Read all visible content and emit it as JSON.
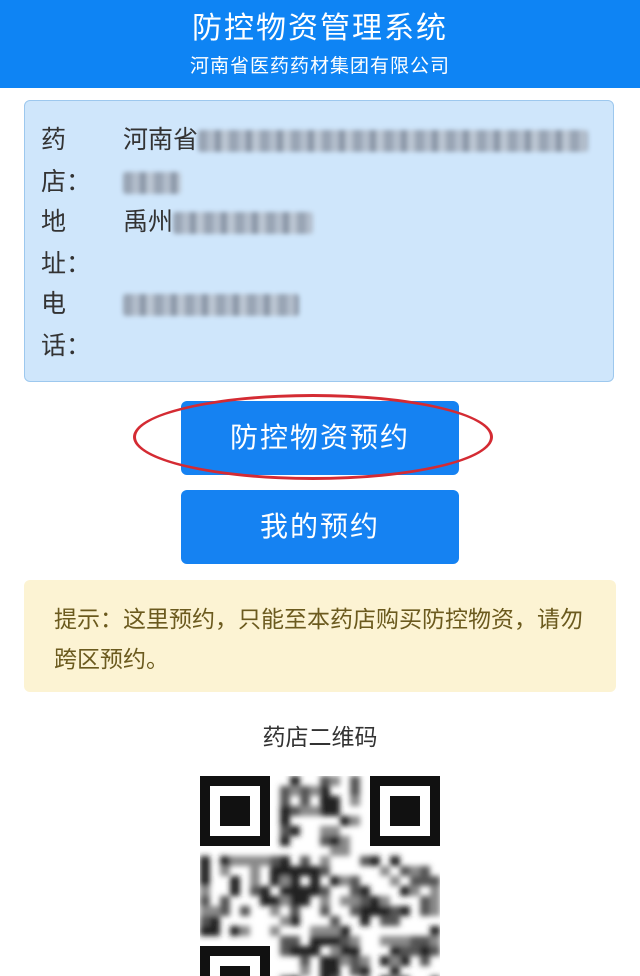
{
  "header": {
    "title": "防控物资管理系统",
    "subtitle": "河南省医药药材集团有限公司"
  },
  "store_info": {
    "name_label": "药店：",
    "name_value_visible": "河南省",
    "address_label": "地址：",
    "address_value_visible": "禹州",
    "phone_label": "电话："
  },
  "actions": {
    "reserve_label": "防控物资预约",
    "my_reservations_label": "我的预约"
  },
  "notice": {
    "text": "提示：这里预约，只能至本药店购买防控物资，请勿跨区预约。"
  },
  "qr": {
    "label": "药店二维码"
  },
  "colors": {
    "header_bg": "#0e84f4",
    "card_bg": "#cfe6fb",
    "button_bg": "#1582f2",
    "highlight_ring": "#d42b33",
    "notice_bg": "#fcf3d3"
  }
}
